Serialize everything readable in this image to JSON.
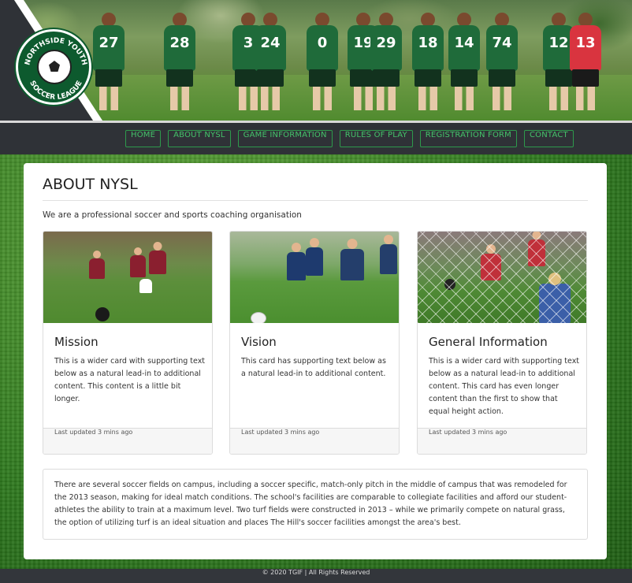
{
  "logo": {
    "text": "NORTHSIDE YOUTH SOCCER LEAGUE"
  },
  "hero": {
    "jersey_numbers": [
      "27",
      "28",
      "3",
      "24",
      "0",
      "19",
      "29",
      "18",
      "14",
      "74",
      "12",
      "13"
    ]
  },
  "nav": {
    "items": [
      {
        "label": "HOME"
      },
      {
        "label": "ABOUT NYSL"
      },
      {
        "label": "GAME INFORMATION"
      },
      {
        "label": "RULES OF PLAY"
      },
      {
        "label": "REGISTRATION FORM"
      },
      {
        "label": "CONTACT"
      }
    ]
  },
  "colors": {
    "nav_accent": "#2e9a4c",
    "header_bg": "#2f3237",
    "team_green": "#1f6b3a"
  },
  "main": {
    "title": "ABOUT NYSL",
    "intro": "We are a professional soccer and sports coaching organisation",
    "cards": [
      {
        "title": "Mission",
        "text": "This is a wider card with supporting text below as a natural lead-in to additional content. This content is a little bit longer.",
        "footer": "Last updated 3 mins ago"
      },
      {
        "title": "Vision",
        "text": "This card has supporting text below as a natural lead-in to additional content.",
        "footer": "Last updated 3 mins ago"
      },
      {
        "title": "General Information",
        "text": "This is a wider card with supporting text below as a natural lead-in to additional content. This card has even longer content than the first to show that equal height action.",
        "footer": "Last updated 3 mins ago"
      }
    ],
    "paragraph": "There are several soccer fields on campus, including a soccer specific, match-only pitch in the middle of campus that was remodeled for the 2013 season, making for ideal match conditions. The school's facilities are comparable to collegiate facilities and afford our student-athletes the ability to train at a maximum level. Two turf fields were constructed in 2013 – while we primarily compete on natural grass, the option of utilizing turf is an ideal situation and places The Hill's soccer facilities amongst the area's best."
  },
  "footer": {
    "text": "© 2020 TGIF | All Rights Reserved"
  }
}
